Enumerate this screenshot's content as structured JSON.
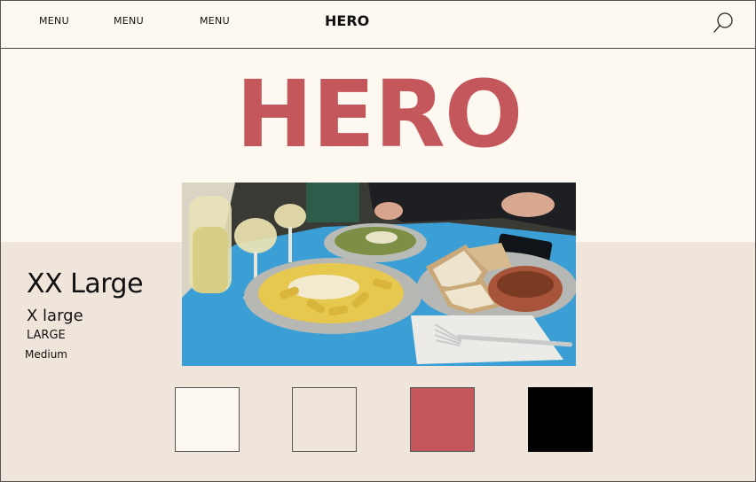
{
  "header": {
    "menu_items": [
      "MENU",
      "MENU",
      "MENU"
    ],
    "brand": "HERO",
    "search_icon": "search-icon"
  },
  "hero": {
    "title": "HERO"
  },
  "type_scale": {
    "xx_large": "XX Large",
    "x_large": "X large",
    "large": "LARGE",
    "medium": "Medium"
  },
  "swatches": [
    {
      "color": "#fdf9f0"
    },
    {
      "color": "#f0e5db"
    },
    {
      "color": "#c4575b"
    },
    {
      "color": "#000000"
    }
  ],
  "colors": {
    "background": "#fdf9f0",
    "band": "#f0e5db",
    "accent": "#c4575b",
    "text": "#111111"
  }
}
